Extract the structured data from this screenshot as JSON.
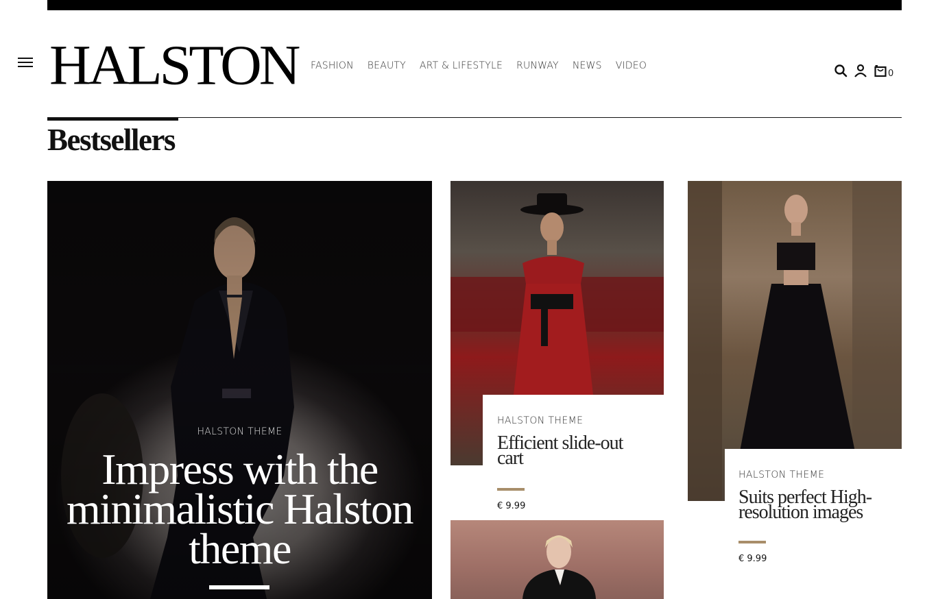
{
  "brand": {
    "logo": "HALSTON"
  },
  "nav": {
    "items": [
      "FASHION",
      "BEAUTY",
      "ART & LIFESTYLE",
      "RUNWAY",
      "NEWS",
      "VIDEO"
    ]
  },
  "utility": {
    "cart_count": "0",
    "icons": [
      "search-icon",
      "user-icon",
      "cart-icon"
    ]
  },
  "section": {
    "title": "Bestsellers"
  },
  "hero": {
    "label": "HALSTON THEME",
    "title": "Impress with the minimalistic Halston theme"
  },
  "products": [
    {
      "kicker": "HALSTON THEME",
      "title": "Efficient slide-out cart",
      "price": "€ 9.99"
    },
    {
      "kicker": "HALSTON THEME",
      "title": "Suits perfect High-resolution images",
      "price": "€ 9.99"
    }
  ],
  "colors": {
    "accent_gold": "#a88e6a",
    "topbar": "#000000"
  }
}
